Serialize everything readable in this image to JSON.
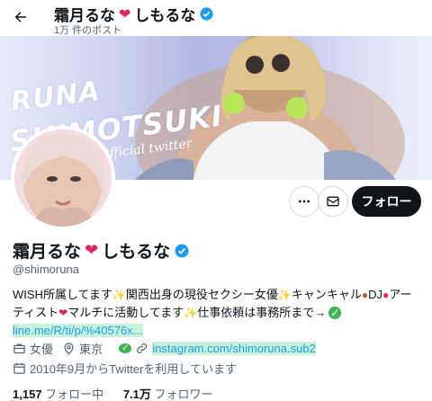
{
  "header": {
    "title": "霜月るな",
    "title_suffix": "しもるな",
    "post_count": "1万 件のポスト"
  },
  "banner": {
    "line1": "RUNA",
    "line2": "SHIMOTSUKI",
    "line3": "Official twitter"
  },
  "actions": {
    "follow_label": "フォロー"
  },
  "profile": {
    "name": "霜月るな",
    "name_suffix": "しもるな",
    "handle": "@shimoruna",
    "bio_part1": "WISH所属してます",
    "bio_part2": "関西出身の現役セクシー女優",
    "bio_part3": "キャンキャル",
    "bio_part4": "DJ",
    "bio_part5": "アーティスト",
    "bio_part6": "マルチに活動してます",
    "bio_part7": "仕事依頼は事務所まで→",
    "bio_link": "line.me/R/ti/p/%40576x...",
    "category": "女優",
    "location": "東京",
    "website": "instagram.com/shimoruna.sub2",
    "joined": "2010年9月からTwitterを利用しています",
    "following_count": "1,157",
    "following_label": "フォロー中",
    "followers_count": "7.1万",
    "followers_label": "フォロワー"
  },
  "colors": {
    "accent": "#1d9bf0",
    "verified": "#1d9bf0",
    "follow_button": "#0f1419",
    "link_highlight": "#c7f3da"
  },
  "icons": [
    "back-arrow-icon",
    "verified-badge-icon",
    "heart-emoji-icon",
    "more-icon",
    "mail-icon",
    "sparkles-emoji-icon",
    "bear-emoji-icon",
    "lips-emoji-icon",
    "check-emoji-icon",
    "briefcase-icon",
    "location-pin-icon",
    "link-icon",
    "calendar-icon"
  ]
}
